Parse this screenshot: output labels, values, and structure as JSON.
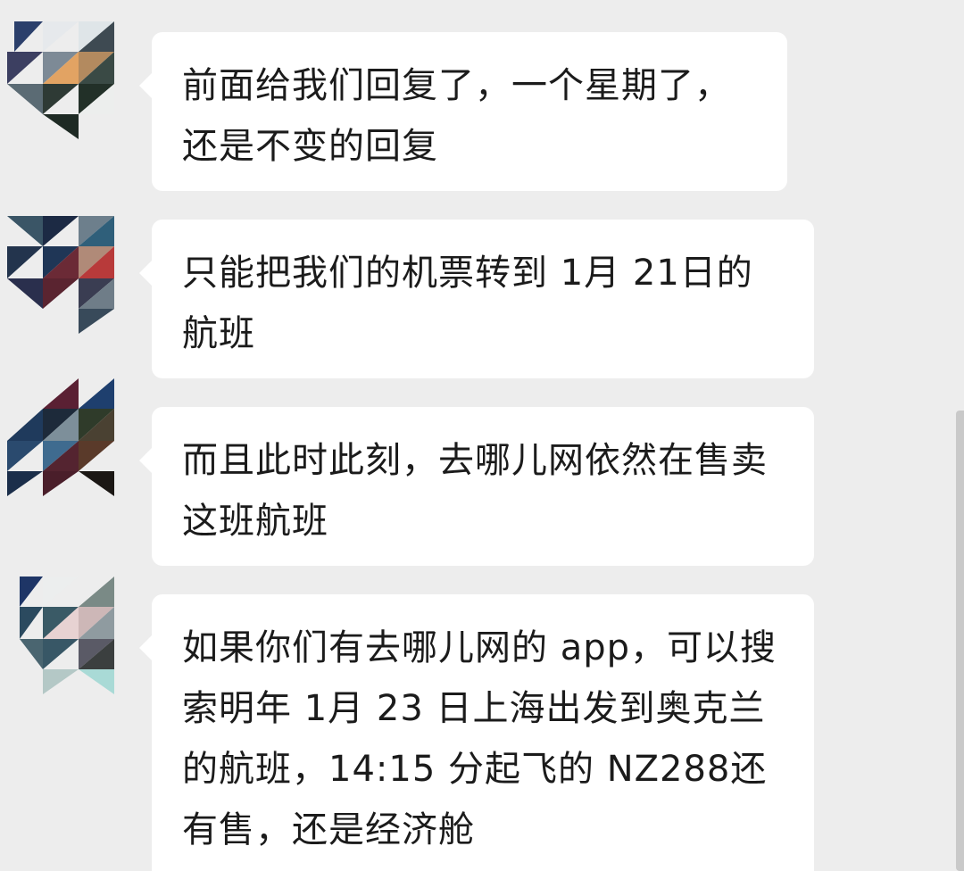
{
  "messages": [
    {
      "text": "前面给我们回复了，一个星期了，还是不变的回复"
    },
    {
      "text": "只能把我们的机票转到 1月 21日的航班"
    },
    {
      "text": "而且此时此刻，去哪儿网依然在售卖这班航班"
    },
    {
      "text": "如果你们有去哪儿网的 app，可以搜索明年 1月 23 日上海出发到奥克兰的航班，14:15 分起飞的 NZ288还有售，还是经济舱"
    }
  ]
}
